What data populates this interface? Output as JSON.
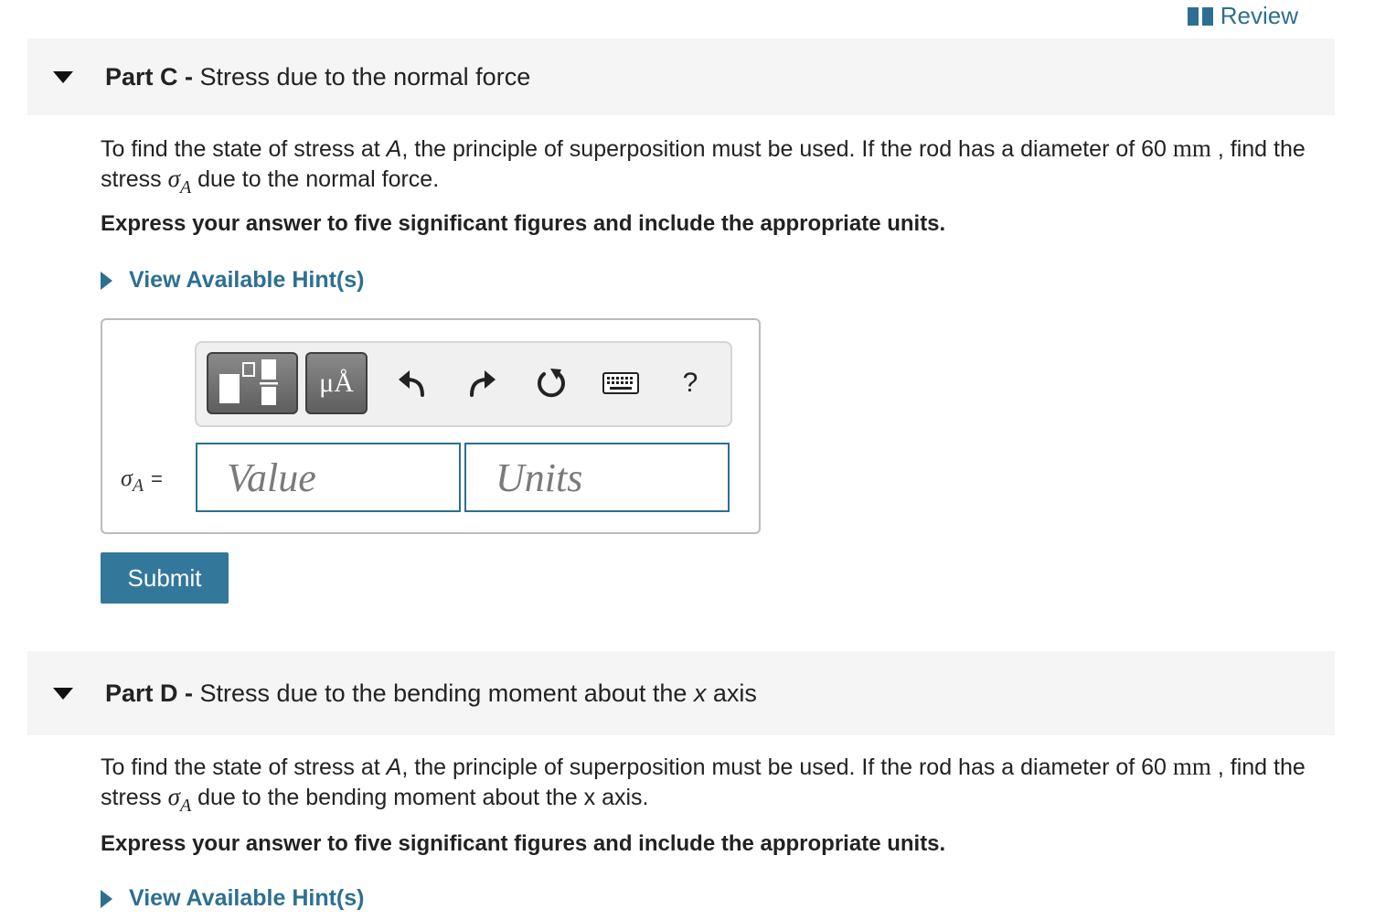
{
  "review": {
    "label": "Review"
  },
  "partC": {
    "header_bold": "Part C - ",
    "header_text": "Stress due to the normal force",
    "prompt": {
      "t1": "To find the state of stress at ",
      "point": "A",
      "t2": ", the principle of superposition must be used. If the rod has a diameter of 60 ",
      "unit": "mm",
      "t3": " , find the stress ",
      "sigma": "σ",
      "sub": "A",
      "t4": " due to the normal force."
    },
    "instruction": "Express your answer to five significant figures and include the appropriate units.",
    "hint": "View Available Hint(s)",
    "toolbar": {
      "units_label": "μÅ",
      "help_label": "?"
    },
    "answer": {
      "lhs_sigma": "σ",
      "lhs_sub": "A",
      "lhs_eq": "=",
      "value_placeholder": "Value",
      "units_placeholder": "Units"
    },
    "submit": "Submit"
  },
  "partD": {
    "header_bold": "Part D - ",
    "header_text_pre": "Stress due to the bending moment about the ",
    "header_axis": "x",
    "header_text_post": " axis",
    "prompt": {
      "t1": "To find the state of stress at ",
      "point": "A",
      "t2": ", the principle of superposition must be used. If the rod has a diameter of 60 ",
      "unit": "mm",
      "t3": " , find the stress ",
      "sigma": "σ",
      "sub": "A",
      "t4": " due to the bending moment about the x axis."
    },
    "instruction": "Express your answer to five significant figures and include the appropriate units.",
    "hint": "View Available Hint(s)"
  },
  "colors": {
    "accent": "#2e6f91",
    "submit_bg": "#33779b",
    "header_bg": "#f5f5f5"
  }
}
